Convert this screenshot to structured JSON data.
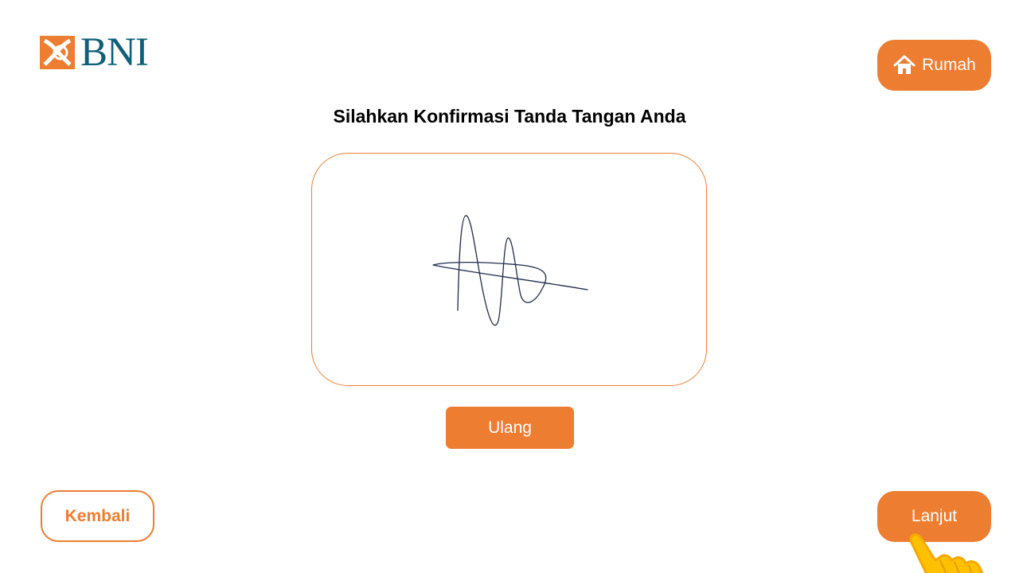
{
  "brand": {
    "logo_text": "BNI",
    "logo_icon": "bni-logo-icon",
    "colors": {
      "orange": "#ed7d31",
      "teal": "#0f5f78",
      "signature_ink": "#1f2d4d"
    }
  },
  "header": {
    "home_label": "Rumah",
    "home_icon": "home-icon"
  },
  "main": {
    "title": "Silahkan Konfirmasi Tanda Tangan Anda",
    "retry_label": "Ulang"
  },
  "footer": {
    "back_label": "Kembali",
    "next_label": "Lanjut",
    "pointer_icon": "hand-pointer-icon"
  }
}
